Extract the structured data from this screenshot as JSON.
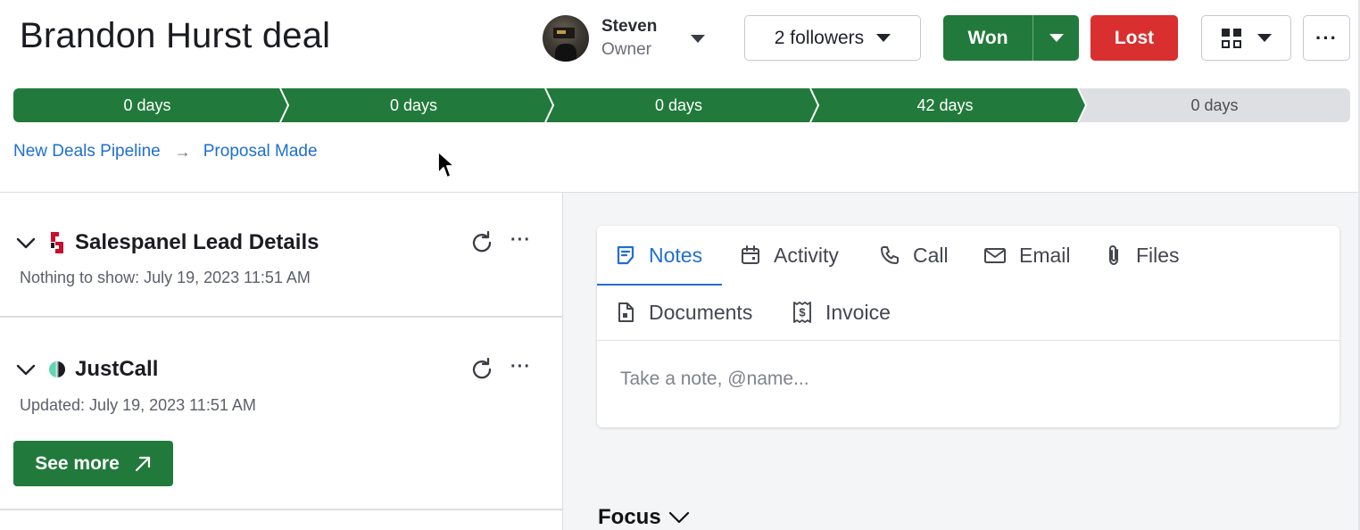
{
  "deal": {
    "title": "Brandon Hurst deal"
  },
  "owner": {
    "name": "Steven",
    "role": "Owner"
  },
  "header": {
    "followers_label": "2 followers",
    "won_label": "Won",
    "lost_label": "Lost",
    "more_label": "···"
  },
  "pipeline": {
    "stages": [
      {
        "label": "0 days",
        "status": "complete"
      },
      {
        "label": "0 days",
        "status": "complete"
      },
      {
        "label": "0 days",
        "status": "complete"
      },
      {
        "label": "42 days",
        "status": "current"
      },
      {
        "label": "0 days",
        "status": "pending"
      }
    ]
  },
  "breadcrumb": {
    "pipeline": "New Deals Pipeline",
    "stage": "Proposal Made"
  },
  "sidebar": {
    "sections": [
      {
        "title": "Salespanel Lead Details",
        "subtitle": "Nothing to show: July 19, 2023 11:51 AM",
        "icon": "salespanel-logo-icon"
      },
      {
        "title": "JustCall",
        "subtitle": "Updated: July 19, 2023 11:51 AM",
        "icon": "justcall-logo-icon"
      }
    ],
    "see_more_label": "See more",
    "more_label": "···"
  },
  "composer": {
    "tabs": [
      {
        "label": "Notes",
        "icon": "notes-icon",
        "active": true
      },
      {
        "label": "Activity",
        "icon": "calendar-icon",
        "active": false
      },
      {
        "label": "Call",
        "icon": "phone-icon",
        "active": false
      },
      {
        "label": "Email",
        "icon": "mail-icon",
        "active": false
      },
      {
        "label": "Files",
        "icon": "paperclip-icon",
        "active": false
      },
      {
        "label": "Documents",
        "icon": "document-icon",
        "active": false
      },
      {
        "label": "Invoice",
        "icon": "invoice-icon",
        "active": false
      }
    ],
    "placeholder": "Take a note, @name..."
  },
  "focus": {
    "label": "Focus"
  },
  "colors": {
    "primary_green": "#217a3b",
    "lost_red": "#d92f2f",
    "link_blue": "#1f6fcf",
    "inactive_stage": "#dedfe2"
  }
}
